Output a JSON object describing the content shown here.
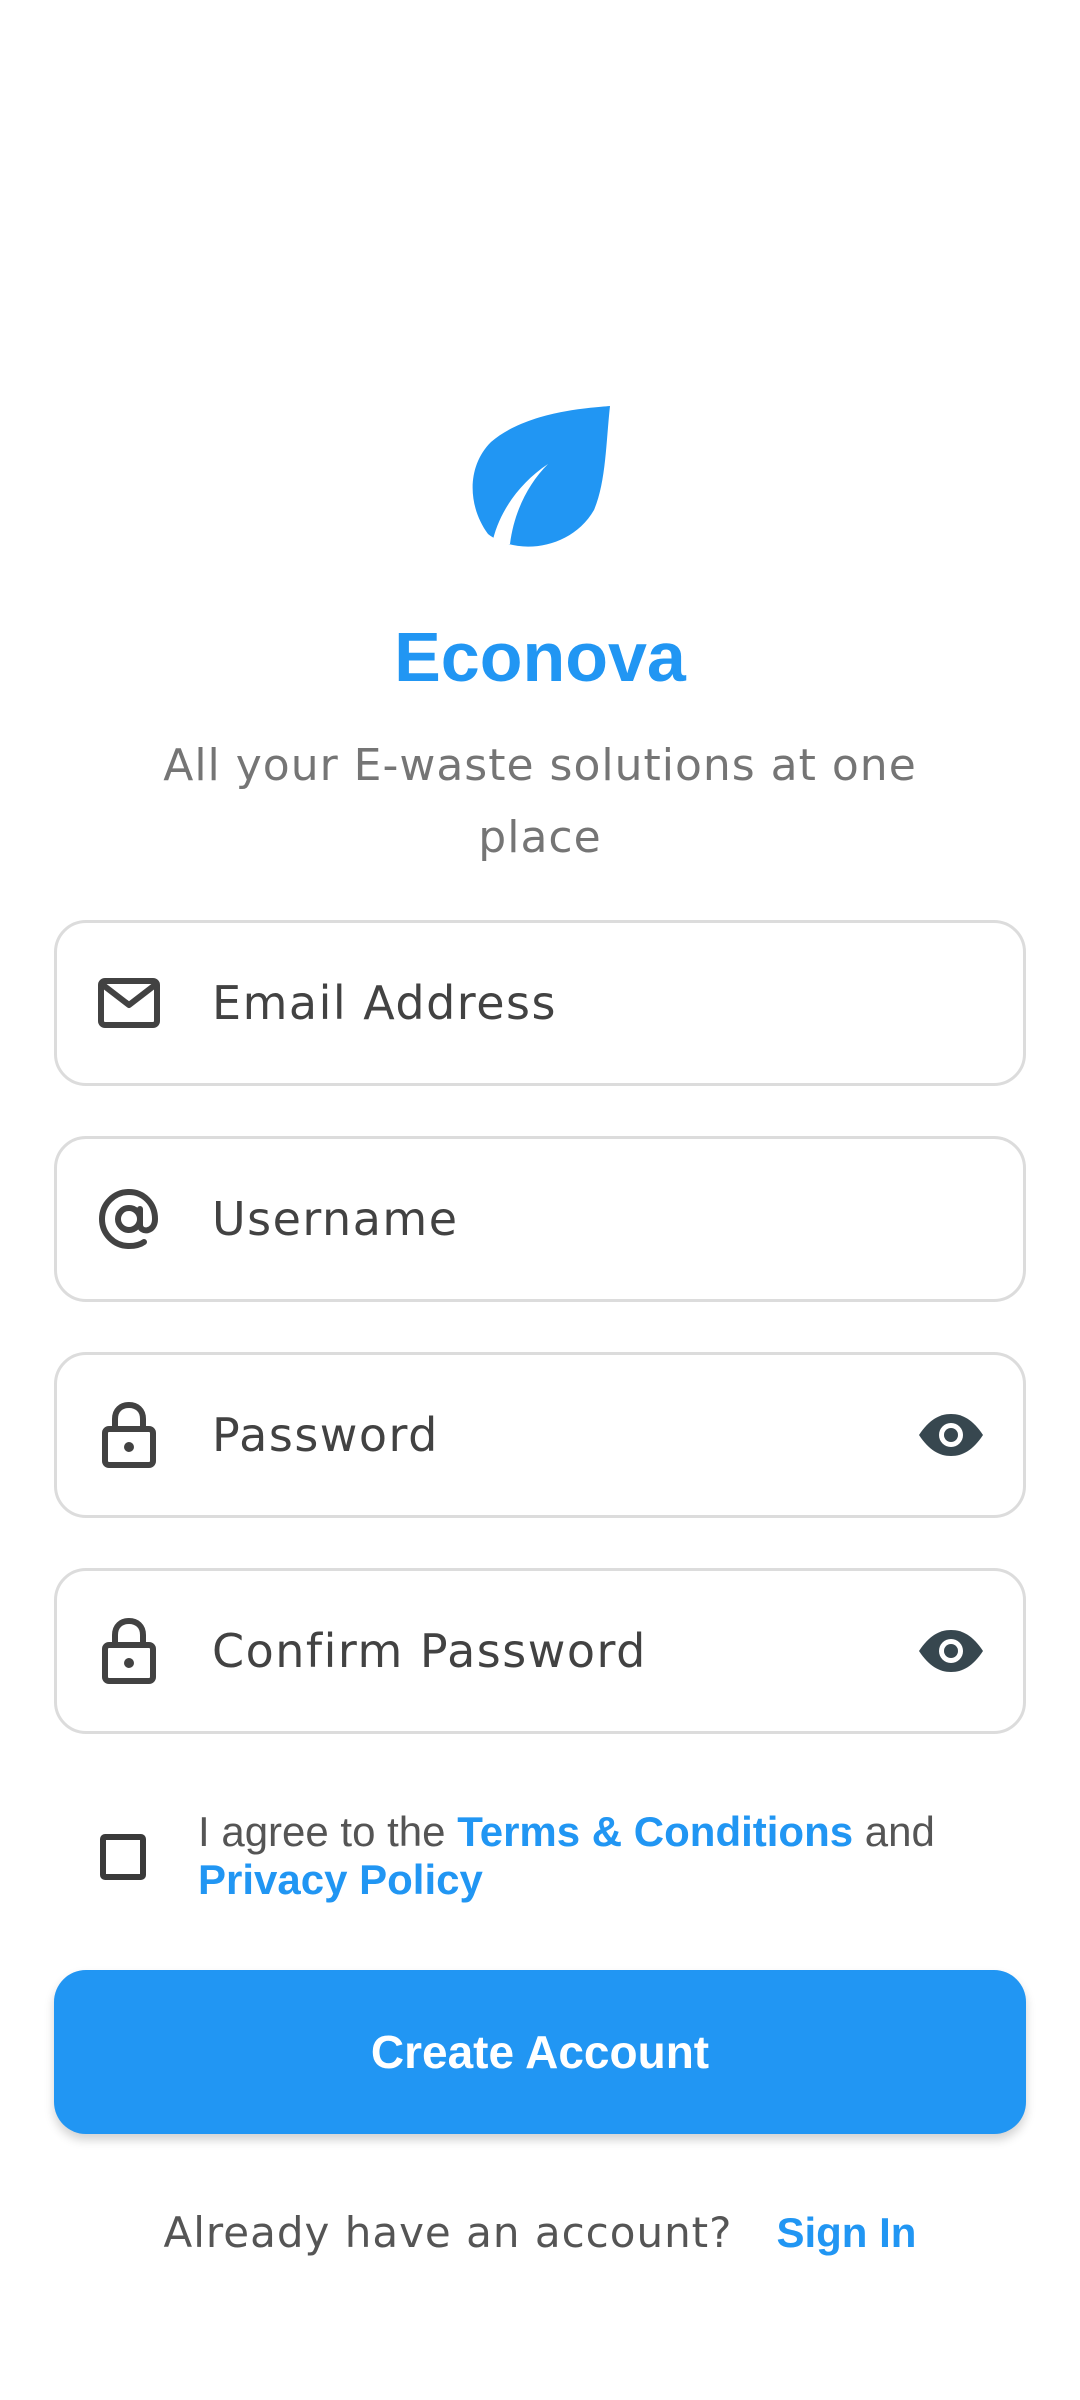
{
  "app": {
    "title": "Econova",
    "tagline": "All your E-waste solutions at one place",
    "accent_color": "#2196F3",
    "logo_icon": "leaf-icon"
  },
  "form": {
    "email": {
      "placeholder": "Email Address",
      "value": "",
      "icon": "mail-icon"
    },
    "username": {
      "placeholder": "Username",
      "value": "",
      "icon": "at-sign-icon"
    },
    "password": {
      "placeholder": "Password",
      "value": "",
      "icon": "lock-icon",
      "toggle_icon": "eye-icon"
    },
    "confirm_password": {
      "placeholder": "Confirm Password",
      "value": "",
      "icon": "lock-icon",
      "toggle_icon": "eye-icon"
    }
  },
  "terms": {
    "checked": false,
    "prefix": "I agree to the ",
    "terms_link": "Terms & Conditions",
    "middle": " and ",
    "privacy_link": "Privacy Policy"
  },
  "actions": {
    "create_account_label": "Create Account",
    "signin_prompt": "Already have an account?",
    "signin_link": "Sign In"
  }
}
